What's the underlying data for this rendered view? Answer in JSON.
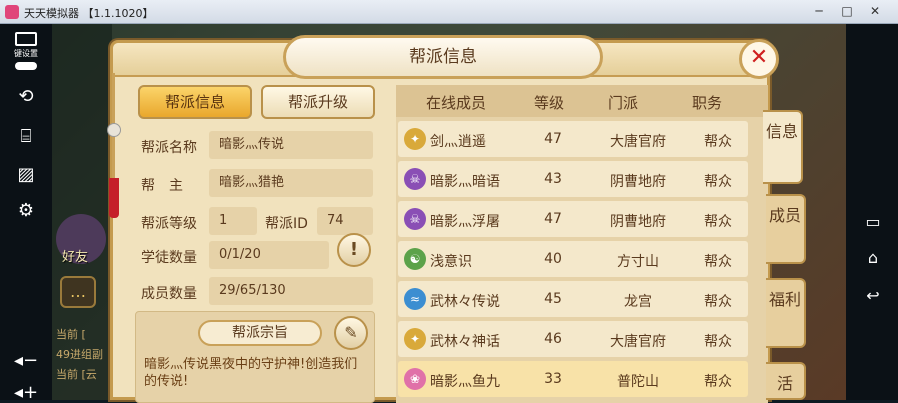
{
  "window": {
    "title": "天天模拟器 【1.1.1020】",
    "minimize": "─",
    "maximize": "□",
    "close": "✕"
  },
  "emulator_left_bar": {
    "keyboard_label": "键设置"
  },
  "background": {
    "friend_label": "好友",
    "chat_lines": [
      "当前 [",
      "49进组副",
      "当前 [云"
    ]
  },
  "panel": {
    "title": "帮派信息",
    "close_symbol": "✕",
    "tabs": [
      "帮派信息",
      "帮派升级"
    ],
    "side_tabs": [
      "信息",
      "成员",
      "福利",
      "活"
    ],
    "fields": {
      "name_label": "帮派名称",
      "name_value": "暗影灬传说",
      "leader_label": "帮　主",
      "leader_value": "暗影灬猎艳",
      "level_label": "帮派等级",
      "level_value": "1",
      "id_label": "帮派ID",
      "id_value": "74",
      "apprentice_label": "学徒数量",
      "apprentice_value": "0/1/20",
      "member_label": "成员数量",
      "member_value": "29/65/130",
      "hint_symbol": "!"
    },
    "purpose": {
      "title": "帮派宗旨",
      "text": "暗影灬传说黑夜中的守护神!创造我们的传说!"
    },
    "member_list": {
      "headers": [
        "在线成员",
        "等级",
        "门派",
        "职务"
      ],
      "rows": [
        {
          "name": "剑灬逍遥",
          "level": "47",
          "sect": "大唐官府",
          "role": "帮众",
          "icon_color": "#d9a93a",
          "icon": "✦"
        },
        {
          "name": "暗影灬暗语",
          "level": "43",
          "sect": "阴曹地府",
          "role": "帮众",
          "icon_color": "#8a4fb5",
          "icon": "☠"
        },
        {
          "name": "暗影灬浮屠",
          "level": "47",
          "sect": "阴曹地府",
          "role": "帮众",
          "icon_color": "#8a4fb5",
          "icon": "☠"
        },
        {
          "name": "浅意识",
          "level": "40",
          "sect": "方寸山",
          "role": "帮众",
          "icon_color": "#5ca24a",
          "icon": "☯"
        },
        {
          "name": "武林々传说",
          "level": "45",
          "sect": "龙宫",
          "role": "帮众",
          "icon_color": "#3c8ed1",
          "icon": "≈"
        },
        {
          "name": "武林々神话",
          "level": "46",
          "sect": "大唐官府",
          "role": "帮众",
          "icon_color": "#d9a93a",
          "icon": "✦"
        },
        {
          "name": "暗影灬鱼九",
          "level": "33",
          "sect": "普陀山",
          "role": "帮众",
          "icon_color": "#e071a8",
          "icon": "❀"
        }
      ]
    }
  }
}
